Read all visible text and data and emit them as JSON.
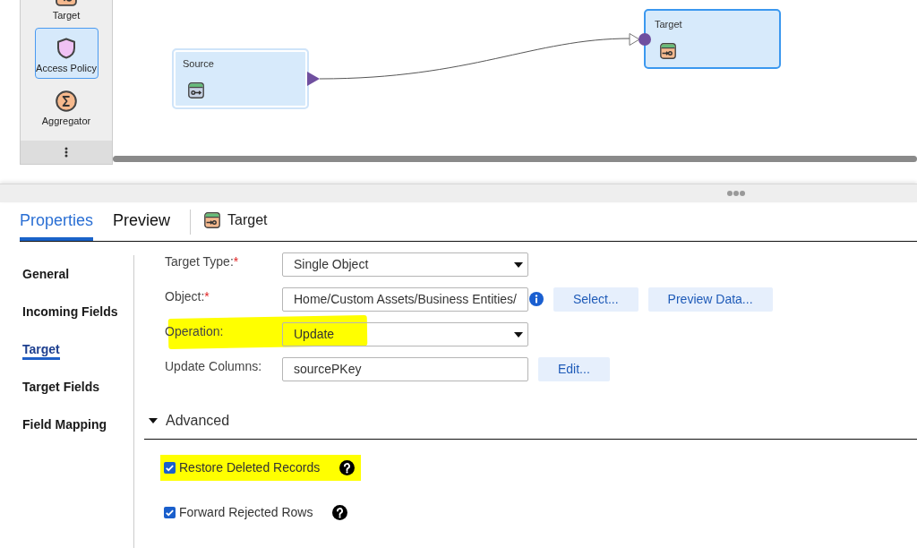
{
  "palette": {
    "items": [
      {
        "kind": "target",
        "label": "Target",
        "selected": false
      },
      {
        "kind": "access_policy",
        "label": "Access Policy",
        "selected": true
      },
      {
        "kind": "aggregator",
        "label": "Aggregator",
        "selected": false
      }
    ]
  },
  "canvas": {
    "nodes": [
      {
        "kind": "source",
        "label": "Source",
        "selected": false
      },
      {
        "kind": "target",
        "label": "Target",
        "selected": true
      }
    ]
  },
  "properties_panel": {
    "tabs": [
      {
        "label": "Properties",
        "selected": true
      },
      {
        "label": "Preview",
        "selected": false
      }
    ],
    "object": {
      "kind": "target",
      "title": "Target"
    },
    "nav": [
      {
        "label": "General",
        "selected": false
      },
      {
        "label": "Incoming Fields",
        "selected": false
      },
      {
        "label": "Target",
        "selected": true
      },
      {
        "label": "Target Fields",
        "selected": false
      },
      {
        "label": "Field Mapping",
        "selected": false
      }
    ],
    "fields": [
      {
        "kind": "select",
        "label": "Target Type:",
        "required_mark": "*",
        "value": "Single Object",
        "highlighted": false
      },
      {
        "kind": "text",
        "label": "Object:",
        "required_mark": "*",
        "value": "Home/Custom Assets/Business Entities/",
        "info": true,
        "buttons": [
          "Select...",
          "Preview Data..."
        ],
        "highlighted": false
      },
      {
        "kind": "select",
        "label": "Operation:",
        "value": "Update",
        "highlighted": true
      },
      {
        "kind": "text",
        "label": "Update Columns:",
        "value": "sourcePKey",
        "buttons": [
          "Edit..."
        ],
        "highlighted": false
      }
    ],
    "advanced": {
      "label": "Advanced",
      "expanded": true,
      "options": [
        {
          "label": "Restore Deleted Records",
          "checked": true,
          "help": true,
          "highlighted": true
        },
        {
          "label": "Forward Rejected Rows",
          "checked": true,
          "help": true,
          "highlighted": false
        }
      ]
    }
  }
}
